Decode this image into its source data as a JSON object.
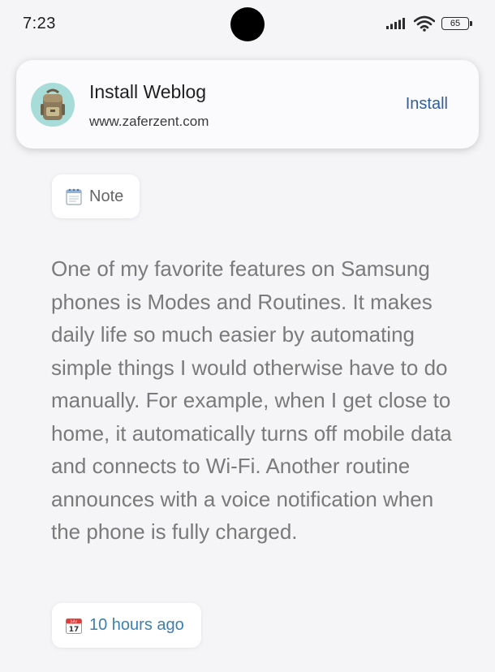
{
  "status_bar": {
    "time": "7:23",
    "battery_level": "65",
    "icons": [
      "signal-icon",
      "wifi-icon",
      "battery-icon"
    ]
  },
  "install_banner": {
    "title": "Install Weblog",
    "url": "www.zaferzent.com",
    "install_label": "Install",
    "accent_color": "#2f5da0",
    "icon": "backpack-icon"
  },
  "post": {
    "tag_label": "Note",
    "tag_icon": "notepad-icon",
    "text": "One of my favorite features on Samsung phones is Modes and Routines. It makes daily life so much easier by automating simple things I would otherwise have to do manually. For example, when I get close to home, it automatically turns off mobile data and connects to Wi-Fi. Another routine announces with a voice notification when the phone is fully charged.",
    "time_label": "10 hours ago",
    "time_icon": "calendar-icon",
    "calendar_icon_text": {
      "month": "July",
      "day": "17"
    },
    "time_color": "#3d7fae"
  }
}
